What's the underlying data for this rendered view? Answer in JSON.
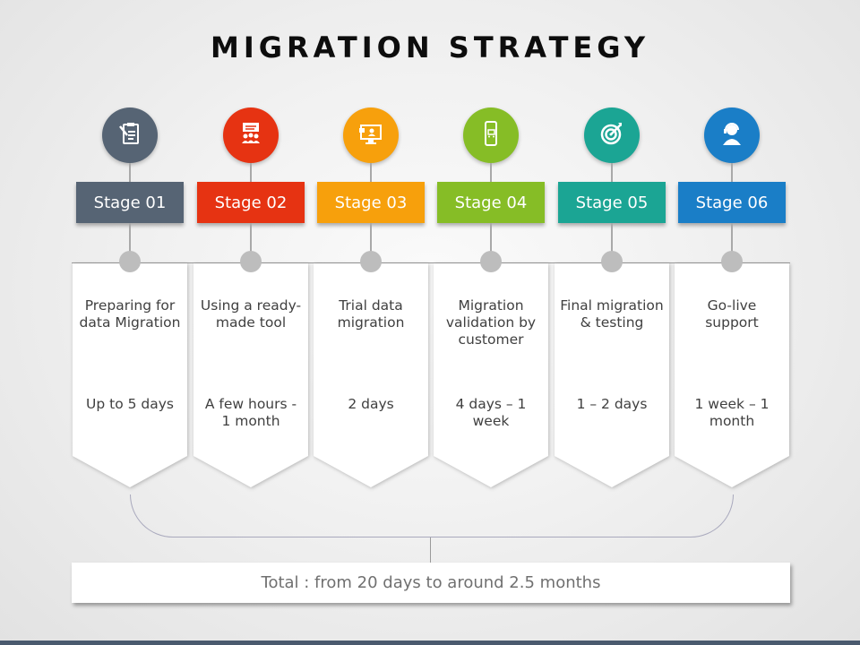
{
  "title": "MIGRATION STRATEGY",
  "stages": [
    {
      "label": "Stage 01",
      "icon": "clipboard-icon",
      "color": "#566474",
      "title": "Preparing for data Migration",
      "duration": "Up to 5 days"
    },
    {
      "label": "Stage 02",
      "icon": "presentation-team-icon",
      "color": "#e63312",
      "title": "Using a ready-made tool",
      "duration": "A few hours - 1 month"
    },
    {
      "label": "Stage 03",
      "icon": "monitor-user-icon",
      "color": "#f7a00c",
      "title": "Trial data migration",
      "duration": "2 days"
    },
    {
      "label": "Stage 04",
      "icon": "mobile-cart-icon",
      "color": "#86bd26",
      "title": "Migration validation by customer",
      "duration": "4 days – 1 week"
    },
    {
      "label": "Stage 05",
      "icon": "target-icon",
      "color": "#1ba594",
      "title": "Final migration & testing",
      "duration": "1 – 2 days"
    },
    {
      "label": "Stage 06",
      "icon": "headset-support-icon",
      "color": "#1a7ec7",
      "title": "Go-live support",
      "duration": "1 week – 1 month"
    }
  ],
  "total": "Total : from 20 days to around 2.5 months"
}
